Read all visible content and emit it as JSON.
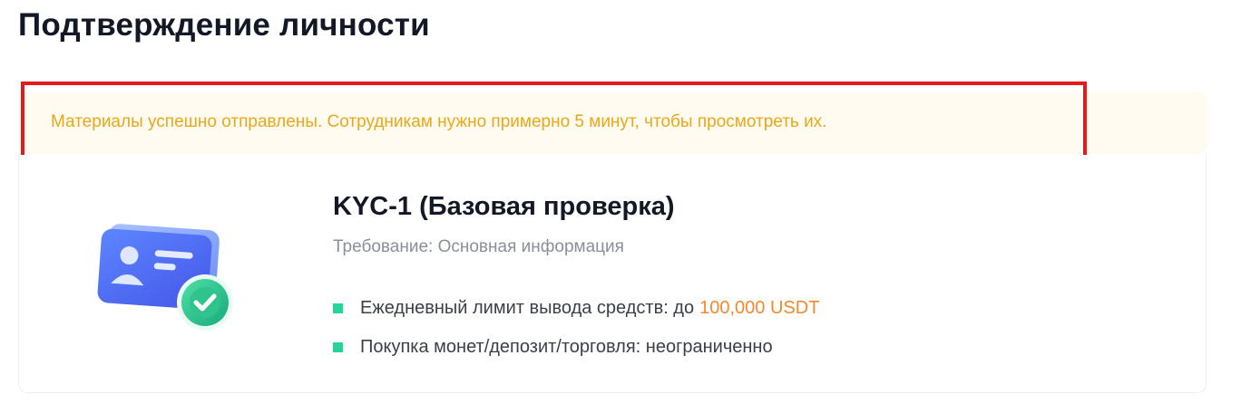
{
  "header": {
    "title": "Подтверждение личности"
  },
  "notice": {
    "message": "Материалы успешно отправлены. Сотрудникам нужно примерно 5 минут, чтобы просмотреть их.",
    "text_color": "#e8a81a",
    "background_color": "#fffbf0",
    "highlight_border_color": "#e41a1a"
  },
  "kyc": {
    "illustration_icon": "id-card-verified-icon",
    "title": "KYC-1  (Базовая проверка)",
    "requirement": "Требование: Основная информация",
    "benefits": [
      {
        "label": "Ежедневный лимит вывода средств: до",
        "value": "100,000 USDT"
      },
      {
        "label": "Покупка монет/депозит/торговля: неограниченно"
      }
    ],
    "bullet_color": "#26d49a",
    "value_color": "#f2892b"
  }
}
